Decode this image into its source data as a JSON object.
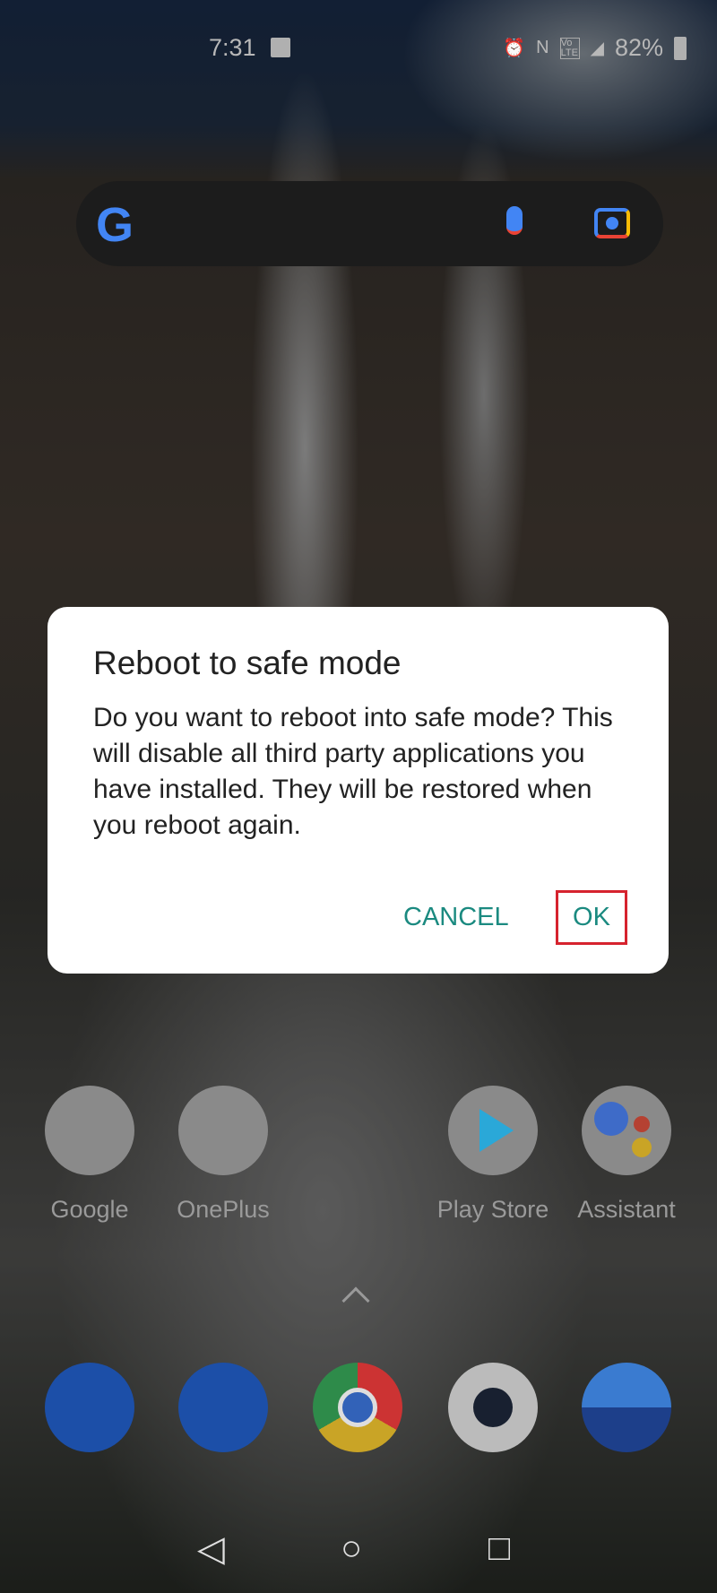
{
  "status_bar": {
    "time": "7:31",
    "battery": "82%",
    "icons": [
      "image-icon",
      "alarm-icon",
      "nfc-icon",
      "volte-icon",
      "signal-icon",
      "battery-icon"
    ],
    "volte": "Vo LTE"
  },
  "search_bar": {
    "icons": [
      "google-g-icon",
      "mic-icon",
      "lens-icon"
    ],
    "logo": "G"
  },
  "dialog": {
    "title": "Reboot to safe mode",
    "message": "Do you want to reboot into safe mode? This will disable all third party applications you have installed. They will be restored when you reboot again.",
    "cancel_label": "CANCEL",
    "ok_label": "OK",
    "accent": "#1b8a80",
    "highlight": "#d6232e"
  },
  "home": {
    "apps": [
      {
        "label": "Google"
      },
      {
        "label": "OnePlus"
      },
      {
        "label": "Play Store"
      },
      {
        "label": "Assistant"
      }
    ]
  },
  "dock": {
    "apps": [
      "phone",
      "messages",
      "chrome",
      "camera",
      "gallery"
    ]
  },
  "nav": {
    "back": "◁",
    "home": "○",
    "recents": "□"
  }
}
